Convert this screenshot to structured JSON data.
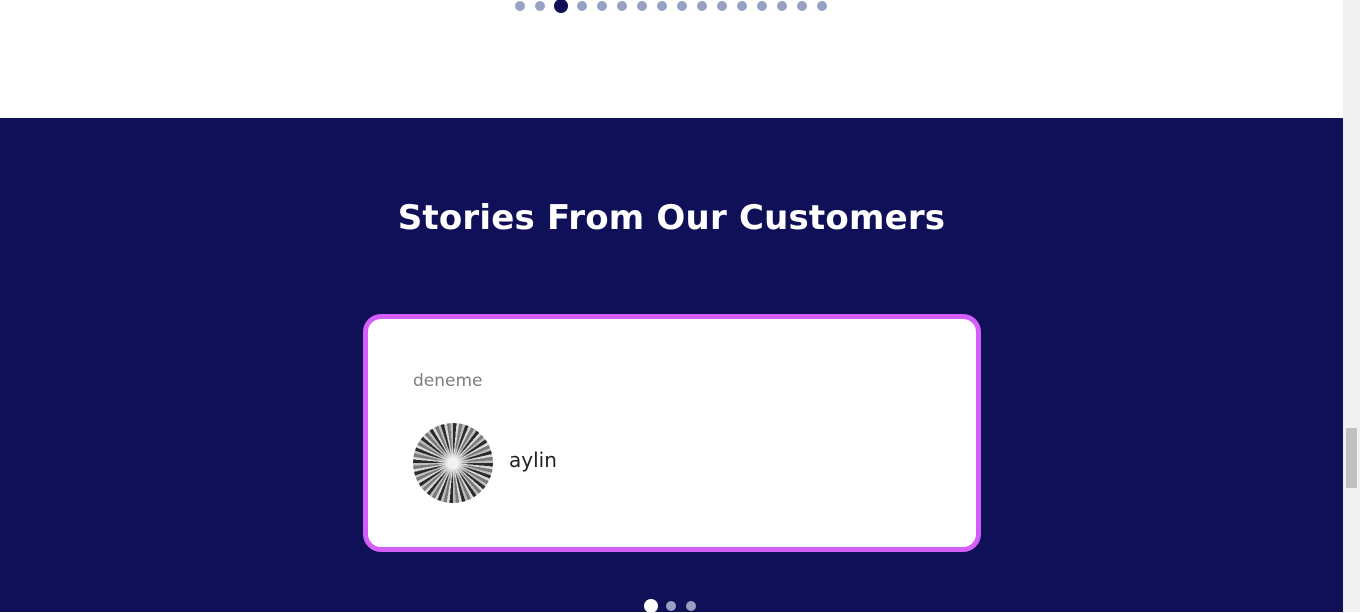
{
  "top_carousel": {
    "dot_count": 16,
    "active_index": 2,
    "active_color": "#101058",
    "inactive_color": "#97a1c3"
  },
  "customers": {
    "title": "Stories From Our Customers",
    "testimonial": {
      "text": "deneme",
      "author": "aylin",
      "avatar_icon": "avatar-photo"
    },
    "dot_count": 3,
    "active_index": 0
  },
  "colors": {
    "section_bg": "#101058",
    "card_border": "#d35ef9",
    "white": "#ffffff"
  }
}
